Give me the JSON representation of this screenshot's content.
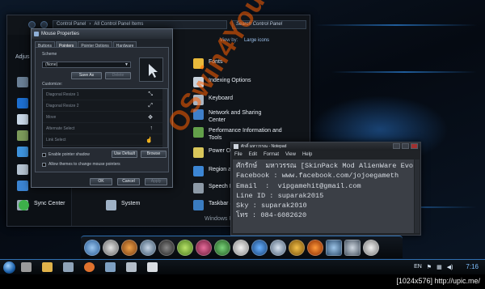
{
  "control_panel": {
    "address_path": [
      "Control Panel",
      "All Control Panel Items"
    ],
    "search_placeholder": "Search Control Panel",
    "left_title": "Adjus",
    "view_by_label": "View by:",
    "view_by_value": "Large icons",
    "items_col2": [
      "Fonts",
      "Indexing Options",
      "Keyboard",
      "Network and Sharing Center",
      "Performance Information and Tools",
      "Power Optio",
      "Region and L",
      "Speech Reco",
      "Taskbar and"
    ],
    "items_col1": [
      "Sync Center",
      "System"
    ],
    "partial_bottom": "Windows F"
  },
  "mouse_properties": {
    "title": "Mouse Properties",
    "tabs": [
      "Buttons",
      "Pointers",
      "Pointer Options",
      "Hardware"
    ],
    "active_tab": "Pointers",
    "scheme_label": "Scheme",
    "scheme_value": "(None)",
    "save_as": "Save As",
    "delete": "Delete",
    "customize_label": "Customize:",
    "customize_rows": [
      "Diagonal Resize 1",
      "Diagonal Resize 2",
      "Move",
      "Alternate Select",
      "Link Select"
    ],
    "enable_shadow": "Enable pointer shadow",
    "allow_themes": "Allow themes to change mouse pointers",
    "use_default": "Use Default",
    "browse": "Browse",
    "ok": "OK",
    "cancel": "Cancel",
    "apply": "Apply"
  },
  "notepad": {
    "title": "ศักดิ์ มหาวรรณ - Notepad",
    "menu": [
      "File",
      "Edit",
      "Format",
      "View",
      "Help"
    ],
    "lines": [
      "ศักรักษ์  มหาวรรณ [SkinPack Mod AlienWare Evolution]",
      "Facebook : www.facebook.com/jojoegameth",
      "Email  :  vipgamehit@gmail.com",
      "Line ID : suparak2015",
      "Sky : suparak2010",
      "โทร : 084-6082620"
    ]
  },
  "watermark": "OSwin4You.com",
  "taskbar": {
    "lang": "EN",
    "clock": "7:16"
  },
  "footer_text": "[1024x576] http://upic.me/",
  "colors": {
    "accent": "#2f6fb0",
    "watermark": "#ff5f00"
  }
}
